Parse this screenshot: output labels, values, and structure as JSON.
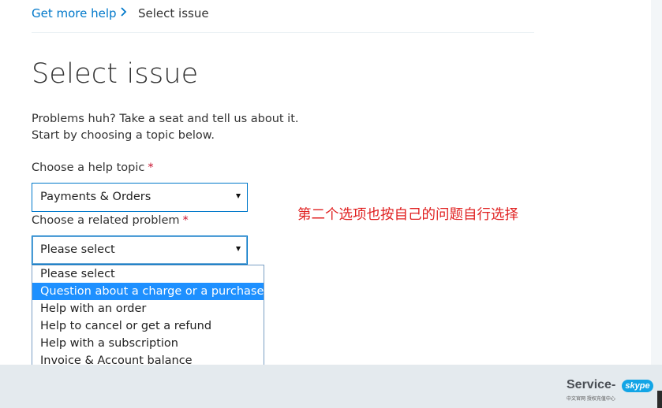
{
  "breadcrumb": {
    "parent": "Get more help",
    "current": "Select issue"
  },
  "page": {
    "title": "Select issue",
    "intro_line1": "Problems huh? Take a seat and tell us about it.",
    "intro_line2": "Start by choosing a topic below."
  },
  "form": {
    "topic_label": "Choose a help topic",
    "topic_required": "*",
    "topic_value": "Payments & Orders",
    "problem_label": "Choose a related problem",
    "problem_required": "*",
    "problem_value": "Please select"
  },
  "dropdown": {
    "options": [
      "Please select",
      "Question about a charge or a purchase",
      "Help with an order",
      "Help to cancel or get a refund",
      "Help with a subscription",
      "Invoice & Account balance"
    ],
    "highlighted_index": 1
  },
  "annotation": "第二个选项也按自己的问题自行选择",
  "watermark": {
    "text": "Service-",
    "badge": "skype",
    "subtext": "中文官网 授权充值中心"
  },
  "colors": {
    "link": "#0078ca",
    "highlight": "#1e90ff",
    "required": "#c8102e",
    "annotation": "#e02020"
  }
}
